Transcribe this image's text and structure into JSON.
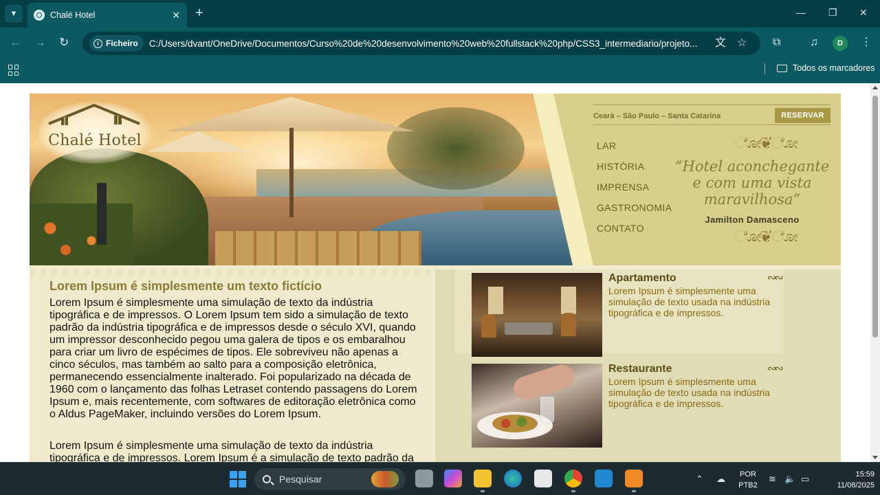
{
  "browser": {
    "tab_title": "Chalé Hotel",
    "site_info_label": "Ficheiro",
    "url": "C:/Users/dvant/OneDrive/Documentos/Curso%20de%20desenvolvimento%20web%20fullstack%20php/CSS3_intermediario/projeto...",
    "bookmarks_all": "Todos os marcadores",
    "profile_initial": "D",
    "accent_color": "#0b5a62"
  },
  "site": {
    "logo_text": "Chalé Hotel",
    "locations": "Ceará – São Paulo – Santa Catarina",
    "reserve_label": "RESERVAR",
    "nav": [
      "LAR",
      "HISTÓRIA",
      "IMPRENSA",
      "GASTRONOMIA",
      "CONTATO"
    ],
    "quote": "“Hotel aconchegante e com uma vista maravilhosa”",
    "quote_author": "Jamilton Damasceno",
    "article": {
      "title": "Lorem Ipsum é simplesmente um texto fictício",
      "paragraph1": "Lorem Ipsum é simplesmente uma simulação de texto da indústria tipográfica e de impressos. O Lorem Ipsum tem sido a simulação de texto padrão da indústria tipográfica e de impressos desde o século XVI, quando um impressor desconhecido pegou uma galera de tipos e os embaralhou para criar um livro de espécimes de tipos. Ele sobreviveu não apenas a cinco séculos, mas também ao salto para a composição eletrônica, permanecendo essencialmente inalterado. Foi popularizado na década de 1960 com o lançamento das folhas Letraset contendo passagens do Lorem Ipsum e, mais recentemente, com softwares de editoração eletrônica como o Aldus PageMaker, incluindo versões do Lorem Ipsum.",
      "paragraph2": "Lorem Ipsum é simplesmente uma simulação de texto da indústria tipográfica e de impressos. Lorem Ipsum é a simulação de texto padrão da"
    },
    "rooms": [
      {
        "title": "Apartamento",
        "description": "Lorem Ipsum é simplesmente uma simulação de texto usada na indústria tipográfica e de impressos."
      },
      {
        "title": "Restaurante",
        "description": "Lorem Ipsum é simplesmente uma simulação de texto usada na indústria tipográfica e de impressos."
      }
    ]
  },
  "taskbar": {
    "search_label": "Pesquisar",
    "language": "POR",
    "keyboard": "PTB2",
    "time": "15:59",
    "date": "11/08/2025"
  }
}
